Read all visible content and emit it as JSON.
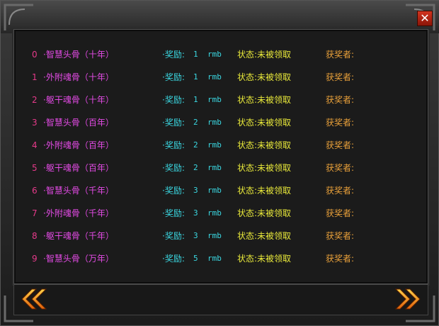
{
  "close_label": "✕",
  "rows": [
    {
      "index": "0",
      "name": "·智慧头骨（十年）",
      "reward_label": "·奖励:",
      "reward_value": "1",
      "reward_unit": "rmb",
      "status": "状态:未被领取",
      "winner": "获奖者:"
    },
    {
      "index": "1",
      "name": "·外附魂骨（十年）",
      "reward_label": "·奖励:",
      "reward_value": "1",
      "reward_unit": "rmb",
      "status": "状态:未被领取",
      "winner": "获奖者:"
    },
    {
      "index": "2",
      "name": "·躯干魂骨（十年）",
      "reward_label": "·奖励:",
      "reward_value": "1",
      "reward_unit": "rmb",
      "status": "状态:未被领取",
      "winner": "获奖者:"
    },
    {
      "index": "3",
      "name": "·智慧头骨（百年）",
      "reward_label": "·奖励:",
      "reward_value": "2",
      "reward_unit": "rmb",
      "status": "状态:未被领取",
      "winner": "获奖者:"
    },
    {
      "index": "4",
      "name": "·外附魂骨（百年）",
      "reward_label": "·奖励:",
      "reward_value": "2",
      "reward_unit": "rmb",
      "status": "状态:未被领取",
      "winner": "获奖者:"
    },
    {
      "index": "5",
      "name": "·躯干魂骨（百年）",
      "reward_label": "·奖励:",
      "reward_value": "2",
      "reward_unit": "rmb",
      "status": "状态:未被领取",
      "winner": "获奖者:"
    },
    {
      "index": "6",
      "name": "·智慧头骨（千年）",
      "reward_label": "·奖励:",
      "reward_value": "3",
      "reward_unit": "rmb",
      "status": "状态:未被领取",
      "winner": "获奖者:"
    },
    {
      "index": "7",
      "name": "·外附魂骨（千年）",
      "reward_label": "·奖励:",
      "reward_value": "3",
      "reward_unit": "rmb",
      "status": "状态:未被领取",
      "winner": "获奖者:"
    },
    {
      "index": "8",
      "name": "·躯干魂骨（千年）",
      "reward_label": "·奖励:",
      "reward_value": "3",
      "reward_unit": "rmb",
      "status": "状态:未被领取",
      "winner": "获奖者:"
    },
    {
      "index": "9",
      "name": "·智慧头骨（万年）",
      "reward_label": "·奖励:",
      "reward_value": "5",
      "reward_unit": "rmb",
      "status": "状态:未被领取",
      "winner": "获奖者:"
    }
  ],
  "icons": {
    "prev": "double-chevron-left-icon",
    "next": "double-chevron-right-icon",
    "close": "close-icon"
  },
  "colors": {
    "index": "#e63a8a",
    "name": "#e44be6",
    "reward": "#3ad6e0",
    "status": "#e8e83a",
    "winner": "#e8a03a",
    "close_bg": "#c02a14"
  }
}
